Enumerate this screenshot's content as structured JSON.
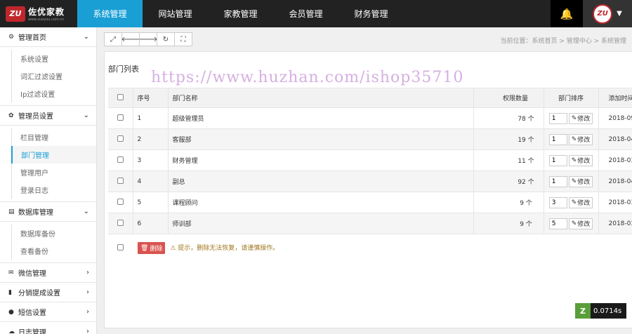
{
  "brand": {
    "logo_mark": "ZU",
    "name": "佐优家教",
    "sub": "www.zuoyou.com.cn",
    "brand_color": "#c0272d"
  },
  "nav": {
    "items": [
      "系统管理",
      "网站管理",
      "家教管理",
      "会员管理",
      "财务管理"
    ],
    "active_index": 0,
    "active_color": "#1a9fd5"
  },
  "user": {
    "avatar_text": "ZU",
    "bell_icon": "bell-icon"
  },
  "sidebar": {
    "groups": [
      {
        "label": "管理首页",
        "icon": "cogs-icon",
        "expanded": true,
        "items": [
          "系统设置",
          "词汇过滤设置",
          "Ip过滤设置"
        ]
      },
      {
        "label": "管理员设置",
        "icon": "gear-icon",
        "expanded": true,
        "items": [
          "栏目管理",
          "部门管理",
          "管理用户",
          "登录日志"
        ],
        "active_item": 1
      },
      {
        "label": "数据库管理",
        "icon": "database-icon",
        "expanded": true,
        "items": [
          "数据库备份",
          "查看备份"
        ]
      },
      {
        "label": "微信管理",
        "icon": "wechat-icon",
        "expanded": false
      },
      {
        "label": "分销提成设置",
        "icon": "chart-icon",
        "expanded": false
      },
      {
        "label": "短信设置",
        "icon": "comment-icon",
        "expanded": false
      },
      {
        "label": "日志管理",
        "icon": "cloud-icon",
        "expanded": false
      }
    ]
  },
  "breadcrumb": "当前位置：系统首页 > 管理中心 > 系统管理",
  "panel": {
    "title": "部门列表",
    "watermark": "https://www.huzhan.com/ishop35710"
  },
  "table": {
    "headers": {
      "no": "序号",
      "name": "部门名称",
      "count": "权限数量",
      "sort": "部门排序",
      "date": "添加时间"
    },
    "rows": [
      {
        "no": "1",
        "name": "超级管理员",
        "count": "78 个",
        "sort": "1",
        "date": "2018-09-"
      },
      {
        "no": "2",
        "name": "客服部",
        "count": "19 个",
        "sort": "1",
        "date": "2018-04-"
      },
      {
        "no": "3",
        "name": "财务管理",
        "count": "11 个",
        "sort": "1",
        "date": "2018-03-"
      },
      {
        "no": "4",
        "name": "副总",
        "count": "92 个",
        "sort": "1",
        "date": "2018-04-"
      },
      {
        "no": "5",
        "name": "课程顾问",
        "count": "9 个",
        "sort": "3",
        "date": "2018-03-"
      },
      {
        "no": "6",
        "name": "师训部",
        "count": "9 个",
        "sort": "5",
        "date": "2018-03-"
      }
    ],
    "edit_label": "修改",
    "delete_label": "删除",
    "warning": "提示，删除无法恢复，请谨慎操作。"
  },
  "timer": {
    "value": "0.0714s"
  }
}
